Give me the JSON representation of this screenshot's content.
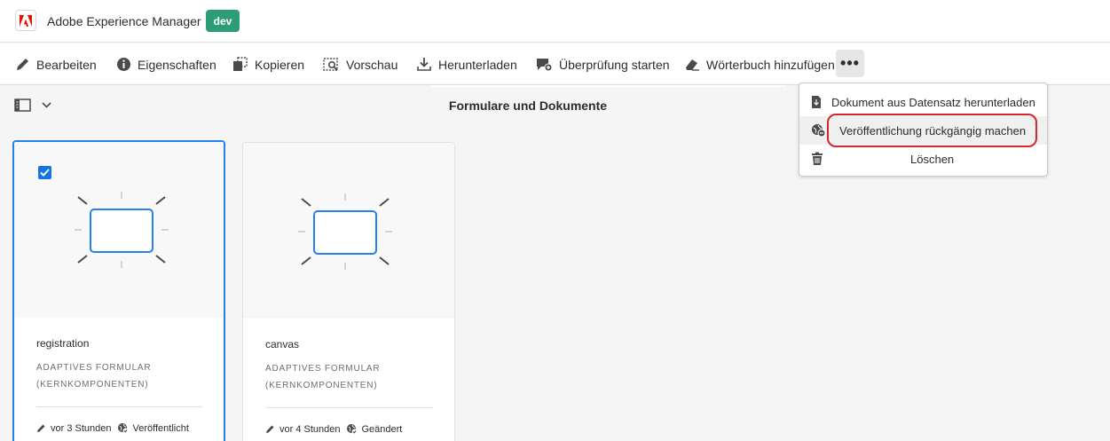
{
  "app": {
    "title": "Adobe Experience Manager",
    "environment_badge": "dev",
    "badge_color": "#2d9d78",
    "logo_icon": "adobe-logo-icon",
    "logo_color": "#eb1000"
  },
  "actionbar": {
    "items": [
      {
        "label": "Bearbeiten",
        "icon": "pencil-icon"
      },
      {
        "label": "Eigenschaften",
        "icon": "info-icon"
      },
      {
        "label": "Kopieren",
        "icon": "copy-icon"
      },
      {
        "label": "Vorschau",
        "icon": "preview-icon"
      },
      {
        "label": "Herunterladen",
        "icon": "download-icon"
      },
      {
        "label": "Überprüfung starten",
        "icon": "review-icon"
      },
      {
        "label": "Wörterbuch hinzufügen",
        "icon": "dictionary-icon"
      }
    ],
    "more_label": "•••"
  },
  "subheader": {
    "view_title": "Formulare und Dokumente",
    "rail_icon": "rail-toggle-icon"
  },
  "cards": [
    {
      "name": "registration",
      "type": "ADAPTIVES FORMULAR (KERNKOMPONENTEN)",
      "modified": "vor 3 Stunden",
      "status": "Veröffentlicht",
      "selected": true
    },
    {
      "name": "canvas",
      "type": "ADAPTIVES FORMULAR (KERNKOMPONENTEN)",
      "modified": "vor 4 Stunden",
      "status": "Geändert",
      "selected": false
    }
  ],
  "more_menu": {
    "items": [
      {
        "label": "Dokument aus Datensatz herunterladen",
        "icon": "document-download-icon"
      },
      {
        "label": "Veröffentlichung rückgängig machen",
        "icon": "unpublish-icon"
      },
      {
        "label": "Löschen",
        "icon": "trash-icon"
      }
    ],
    "highlight_color": "#d7262e"
  },
  "accent_color": "#2680eb"
}
